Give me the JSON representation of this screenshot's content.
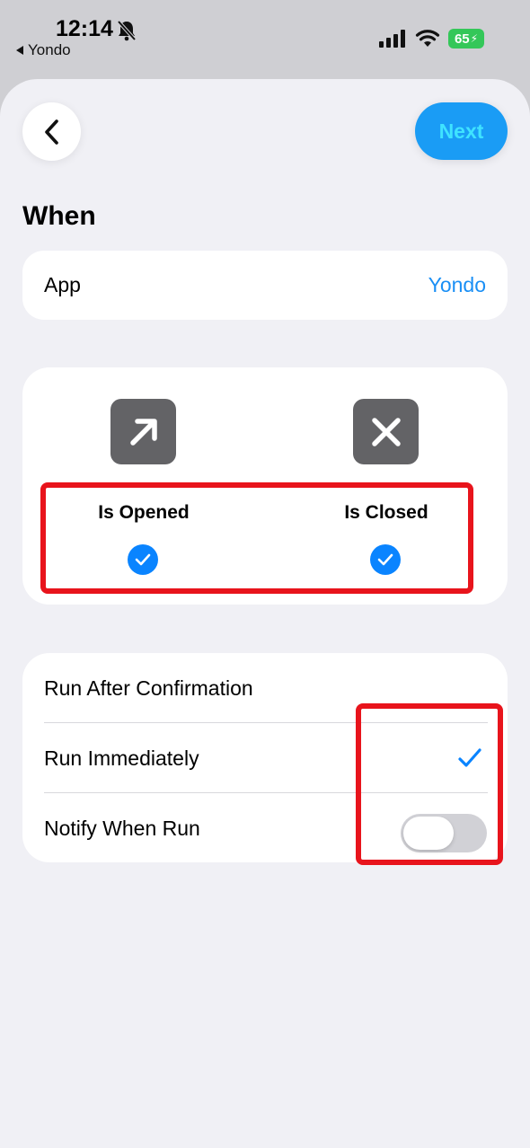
{
  "status_bar": {
    "time": "12:14",
    "back_app": "Yondo",
    "battery": "65"
  },
  "nav": {
    "next_label": "Next"
  },
  "section": {
    "title": "When"
  },
  "app_row": {
    "label": "App",
    "value": "Yondo"
  },
  "events": [
    {
      "label": "Is Opened",
      "icon": "arrow-up-right-icon",
      "checked": true
    },
    {
      "label": "Is Closed",
      "icon": "xmark-icon",
      "checked": true
    }
  ],
  "options": [
    {
      "label": "Run After Confirmation",
      "selected": false
    },
    {
      "label": "Run Immediately",
      "selected": true
    },
    {
      "label": "Notify When Run",
      "toggle": false
    }
  ],
  "colors": {
    "accent": "#0a84ff",
    "next_button_bg": "#1a9cf5",
    "next_button_text": "#3fe3ff",
    "highlight": "#e8141c",
    "battery": "#34c759"
  }
}
